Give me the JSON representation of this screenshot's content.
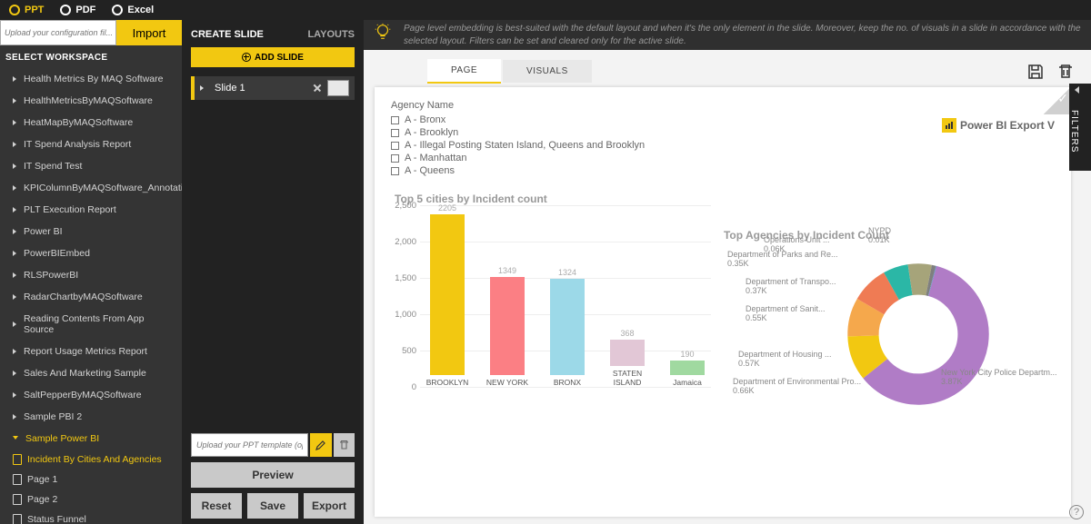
{
  "radios": {
    "ppt": "PPT",
    "pdf": "PDF",
    "excel": "Excel"
  },
  "config_placeholder": "Upload your configuration fil...",
  "import_label": "Import",
  "select_workspace": "SELECT WORKSPACE",
  "workspaces": [
    "Health Metrics By MAQ Software",
    "HealthMetricsByMAQSoftware",
    "HeatMapByMAQSoftware",
    "IT Spend Analysis Report",
    "IT Spend Test",
    "KPIColumnByMAQSoftware_Annotation",
    "PLT Execution Report",
    "Power BI",
    "PowerBIEmbed",
    "RLSPowerBI",
    "RadarChartbyMAQSoftware",
    "Reading Contents From App Source",
    "Report Usage Metrics Report",
    "Sales And Marketing Sample",
    "SaltPepperByMAQSoftware",
    "Sample PBI 2",
    "Sample Power BI"
  ],
  "pages": [
    "Incident By Cities And Agencies",
    "Page 1",
    "Page 2",
    "Status Funnel"
  ],
  "mid": {
    "create": "CREATE SLIDE",
    "layouts": "LAYOUTS",
    "add_slide": "ADD SLIDE",
    "slide1": "Slide 1",
    "ppt_tpl_placeholder": "Upload your PPT template (optio...",
    "preview": "Preview",
    "reset": "Reset",
    "save": "Save",
    "export": "Export"
  },
  "tip": "Page level embedding is best-suited with the default layout and when it's the only element in the slide. Moreover, keep the no. of visuals in a slide in accordance with the selected layout. Filters can be set and cleared only for the active slide.",
  "tabs": {
    "page": "PAGE",
    "visuals": "VISUALS"
  },
  "pbi_brand": "Power BI Export V",
  "filters_tab": "FILTERS",
  "filter": {
    "title": "Agency Name",
    "items": [
      "A - Bronx",
      "A - Brooklyn",
      "A - Illegal Posting Staten Island, Queens and Brooklyn",
      "A - Manhattan",
      "A - Queens"
    ]
  },
  "chart_data": [
    {
      "type": "bar",
      "title": "Top 5 cities by Incident count",
      "categories": [
        "BROOKLYN",
        "NEW YORK",
        "BRONX",
        "STATEN ISLAND",
        "Jamaica"
      ],
      "values": [
        2205,
        1349,
        1324,
        368,
        190
      ],
      "ylim": [
        0,
        2500
      ],
      "ystep": 500,
      "colors": [
        "#f2c811",
        "#fb7f84",
        "#9cd9e8",
        "#e2c7d6",
        "#a0d9a0"
      ]
    },
    {
      "type": "donut",
      "title": "Top Agencies by Incident Count",
      "series": [
        {
          "name": "New York City Police Departm...",
          "value": 3870,
          "label": "3.87K",
          "color": "#b07cc6"
        },
        {
          "name": "Department of Environmental Pro...",
          "value": 660,
          "label": "0.66K",
          "color": "#f2c811"
        },
        {
          "name": "Department of Housing ...",
          "value": 570,
          "label": "0.57K",
          "color": "#f5a84c"
        },
        {
          "name": "Department of Sanit...",
          "value": 550,
          "label": "0.55K",
          "color": "#ef7b54"
        },
        {
          "name": "Department of Transpo...",
          "value": 370,
          "label": "0.37K",
          "color": "#2bb7a6"
        },
        {
          "name": "Department of Parks and Re...",
          "value": 350,
          "label": "0.35K",
          "color": "#a6a47a"
        },
        {
          "name": "Operations Unit ...",
          "value": 60,
          "label": "0.06K",
          "color": "#7f7f7f"
        },
        {
          "name": "NYPD",
          "value": 10,
          "label": "0.01K",
          "color": "#5a8fbf"
        }
      ]
    }
  ]
}
